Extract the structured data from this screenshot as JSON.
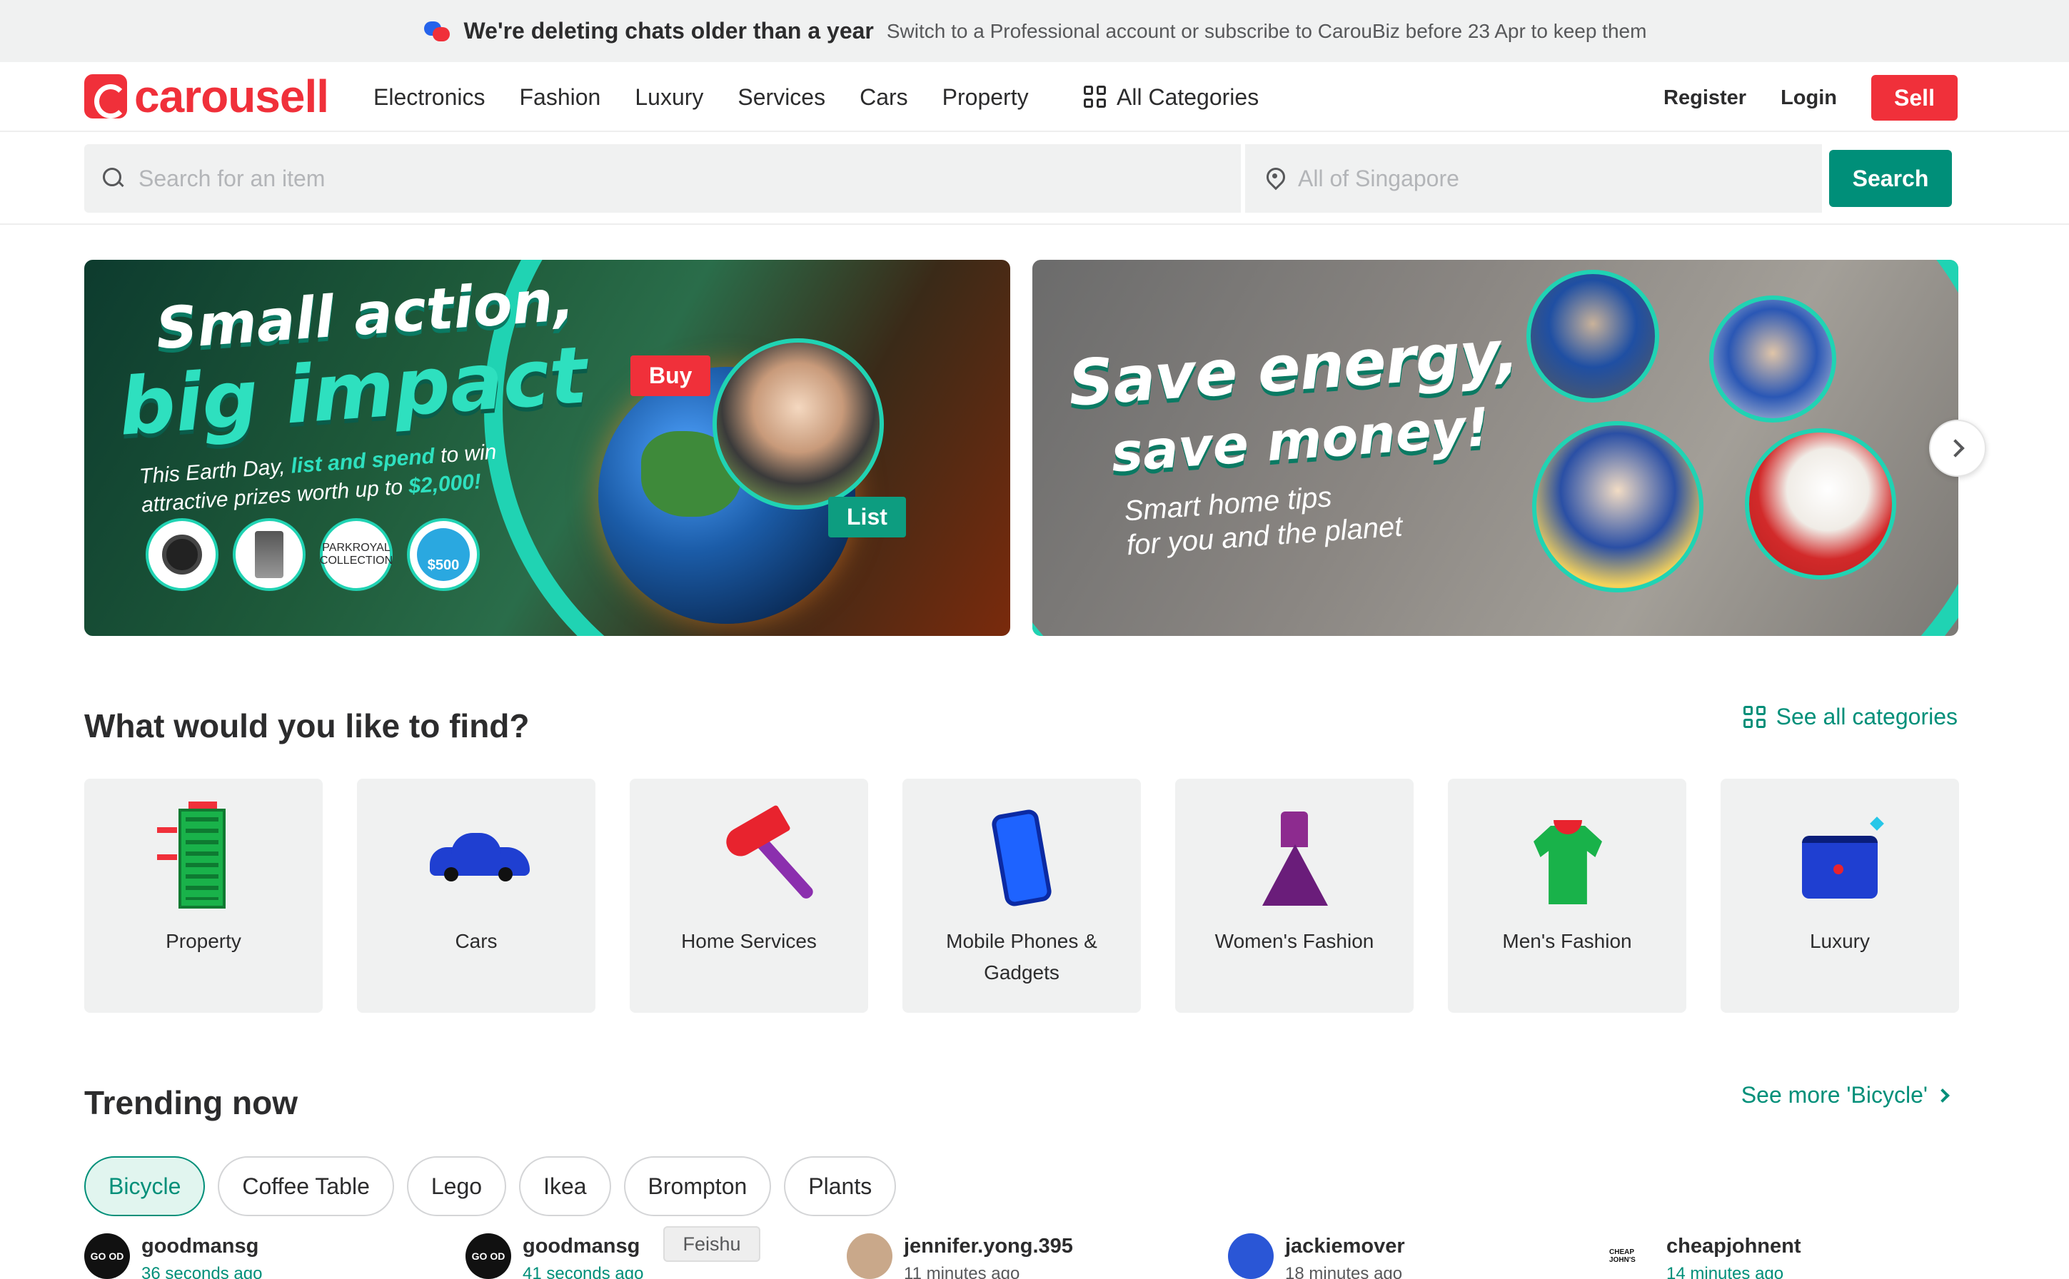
{
  "announcement": {
    "title": "We're deleting chats older than a year",
    "subtitle": "Switch to a Professional account or subscribe to CarouBiz before 23 Apr to keep them"
  },
  "header": {
    "logo_text": "carousell",
    "nav": [
      "Electronics",
      "Fashion",
      "Luxury",
      "Services",
      "Cars",
      "Property"
    ],
    "all_categories": "All Categories",
    "register": "Register",
    "login": "Login",
    "sell": "Sell"
  },
  "search": {
    "placeholder": "Search for an item",
    "location_placeholder": "All of Singapore",
    "button": "Search"
  },
  "banners": {
    "banner1": {
      "title_line1": "Small action,",
      "title_line2": "big impact",
      "copy_pre": "This Earth Day, ",
      "copy_highlight": "list and spend",
      "copy_mid": " to win attractive prizes worth up to ",
      "copy_amount": "$2,000!",
      "buy_tag": "Buy",
      "list_tag": "List",
      "prize_logo": "PARKROYAL COLLECTION",
      "prize_voucher": "$500"
    },
    "banner2": {
      "title_line1": "Save energy,",
      "title_line2": "save money!",
      "copy_line1": "Smart home tips",
      "copy_line2": "for you and the planet"
    }
  },
  "categories": {
    "title": "What would you like to find?",
    "see_all": "See all categories",
    "items": [
      {
        "label": "Property",
        "icon": "building-icon"
      },
      {
        "label": "Cars",
        "icon": "car-icon"
      },
      {
        "label": "Home Services",
        "icon": "hammer-icon"
      },
      {
        "label": "Mobile Phones & Gadgets",
        "icon": "phone-icon"
      },
      {
        "label": "Women's Fashion",
        "icon": "dress-icon"
      },
      {
        "label": "Men's Fashion",
        "icon": "shirt-icon"
      },
      {
        "label": "Luxury",
        "icon": "bag-icon"
      }
    ]
  },
  "trending": {
    "title": "Trending now",
    "see_more": "See more 'Bicycle'",
    "chips": [
      "Bicycle",
      "Coffee Table",
      "Lego",
      "Ikea",
      "Brompton",
      "Plants"
    ],
    "active_chip": "Bicycle",
    "tooltip": "Feishu",
    "sellers": [
      {
        "name": "goodmansg",
        "time": "36 seconds ago",
        "avatar": "GO OD"
      },
      {
        "name": "goodmansg",
        "time": "41 seconds ago",
        "avatar": "GO OD"
      },
      {
        "name": "jennifer.yong.395",
        "time": "11 minutes ago",
        "avatar": ""
      },
      {
        "name": "jackiemover",
        "time": "18 minutes ago",
        "avatar": ""
      },
      {
        "name": "cheapjohnent",
        "time": "14 minutes ago",
        "avatar": "CHEAP JOHN'S"
      }
    ]
  },
  "colors": {
    "brand_red": "#f0303a",
    "accent_green": "#008f79",
    "banner_teal": "#20d3b3"
  }
}
